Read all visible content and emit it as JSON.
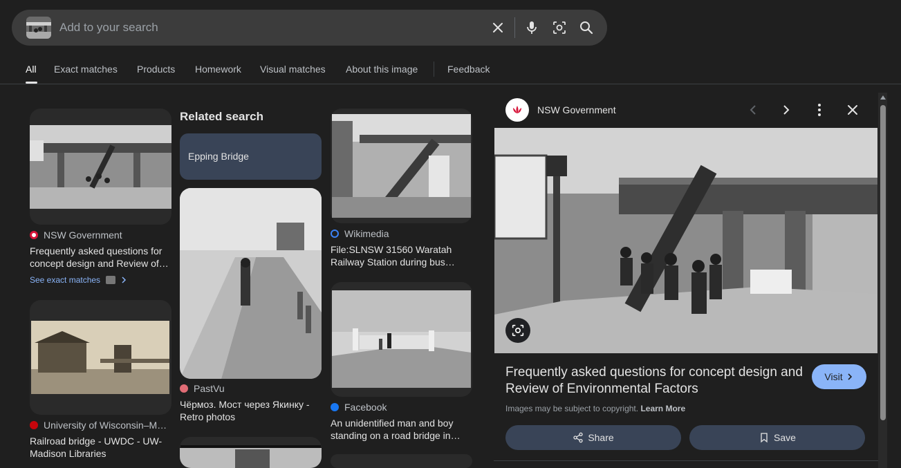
{
  "search": {
    "placeholder": "Add to your search",
    "value": ""
  },
  "tabs": [
    {
      "label": "All",
      "active": true
    },
    {
      "label": "Exact matches"
    },
    {
      "label": "Products"
    },
    {
      "label": "Homework"
    },
    {
      "label": "Visual matches"
    },
    {
      "label": "About this image"
    },
    {
      "label": "Feedback"
    }
  ],
  "results": {
    "col1": [
      {
        "source": "NSW Government",
        "title": "Frequently asked questions for concept design and Review of…",
        "see_exact": "See exact matches"
      },
      {
        "source": "University of Wisconsin–M…",
        "title": "Railroad bridge - UWDC - UW-Madison Libraries"
      }
    ],
    "related": {
      "heading": "Related search",
      "chip": "Epping Bridge"
    },
    "col2": [
      {
        "source": "PastVu",
        "title": "Чёрмоз. Мост через Якинку - Retro photos"
      }
    ],
    "col3": [
      {
        "source": "Wikimedia",
        "title": "File:SLNSW 31560 Waratah Railway Station during bus…"
      },
      {
        "source": "Facebook",
        "title": "An unidentified man and boy standing on a road bridge in…"
      }
    ]
  },
  "panel": {
    "source": "NSW Government",
    "title": "Frequently asked questions for concept design and Review of Environmental Factors",
    "visit_label": "Visit",
    "copyright_text": "Images may be subject to copyright.",
    "learn_more": "Learn More",
    "share_label": "Share",
    "save_label": "Save"
  },
  "colors": {
    "background": "#1f1f1f",
    "accent": "#8ab4f8",
    "chip": "#394457"
  }
}
